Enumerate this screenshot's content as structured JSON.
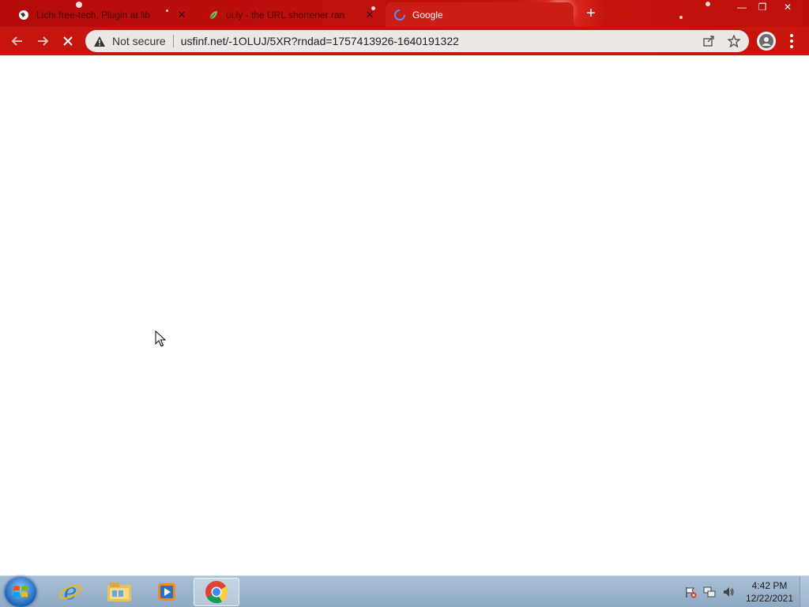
{
  "browser": {
    "tabs": [
      {
        "title": "Lichi free-tech, Plugin at lib",
        "favicon": "globe-icon",
        "active": false
      },
      {
        "title": "ui.ly - the URL shortener ran",
        "favicon": "leaf-icon",
        "active": false
      },
      {
        "title": "Google",
        "favicon": "loading-spinner-icon",
        "active": true
      }
    ],
    "close_glyph": "✕",
    "new_tab_glyph": "+",
    "window_controls": {
      "minimize": "—",
      "restore": "❐",
      "close": "✕"
    },
    "omnibox": {
      "security_label": "Not secure",
      "url": "usfinf.net/-1OLUJ/5XR?rndad=1757413926-1640191322"
    }
  },
  "taskbar": {
    "apps": [
      {
        "name": "internet-explorer-icon",
        "active": false
      },
      {
        "name": "file-explorer-icon",
        "active": false
      },
      {
        "name": "media-player-icon",
        "active": false
      },
      {
        "name": "chrome-icon",
        "active": true
      }
    ],
    "clock": {
      "time": "4:42 PM",
      "date": "12/22/2021"
    }
  },
  "colors": {
    "accent": "#c91d16",
    "taskbar": "#9fb6cd"
  }
}
